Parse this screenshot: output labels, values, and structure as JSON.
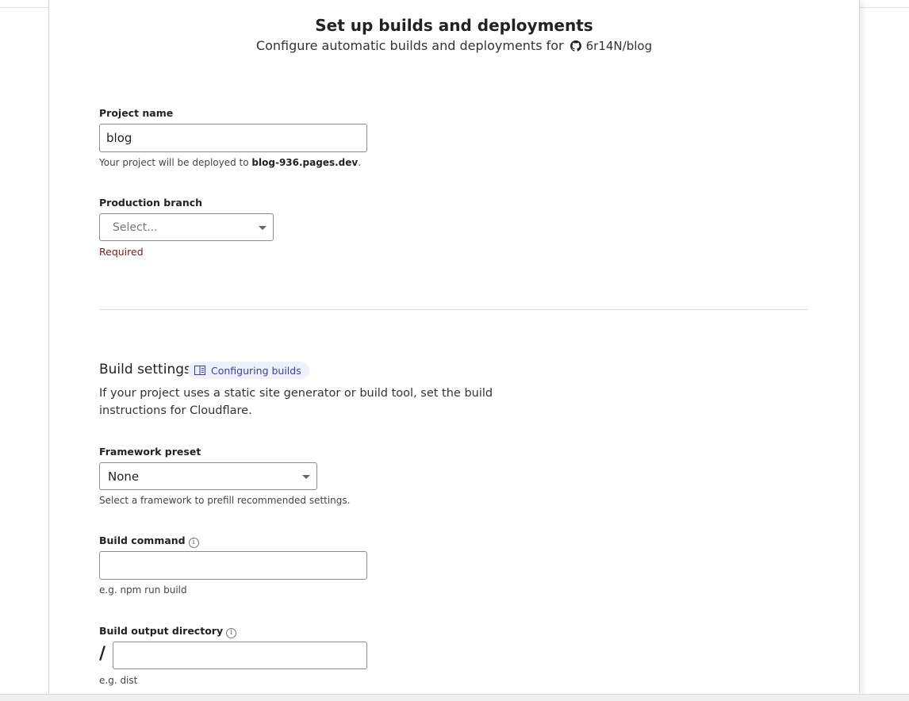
{
  "header": {
    "title": "Set up builds and deployments",
    "subtitle_prefix": "Configure automatic builds and deployments for",
    "repo": "6r14N/blog",
    "repo_icon": "github-icon"
  },
  "project": {
    "label": "Project name",
    "value": "blog",
    "help_prefix": "Your project will be deployed to ",
    "help_domain": "blog-936.pages.dev",
    "help_suffix": "."
  },
  "branch": {
    "label": "Production branch",
    "placeholder": "Select...",
    "required_text": "Required"
  },
  "build": {
    "section_title": "Build settings",
    "docs_link": "Configuring builds",
    "docs_icon": "book-icon",
    "description": "If your project uses a static site generator or build tool, set the build instructions for Cloudflare.",
    "framework_label": "Framework preset",
    "framework_value": "None",
    "framework_help": "Select a framework to prefill recommended settings.",
    "command_label": "Build command",
    "command_value": "",
    "command_help": "e.g. npm run build",
    "output_label": "Build output directory",
    "output_prefix": "/",
    "output_value": "",
    "output_help": "e.g. dist"
  },
  "colors": {
    "accent": "#3b3ea8",
    "pill_bg": "#eef0fb",
    "required": "#7a1a1a"
  }
}
